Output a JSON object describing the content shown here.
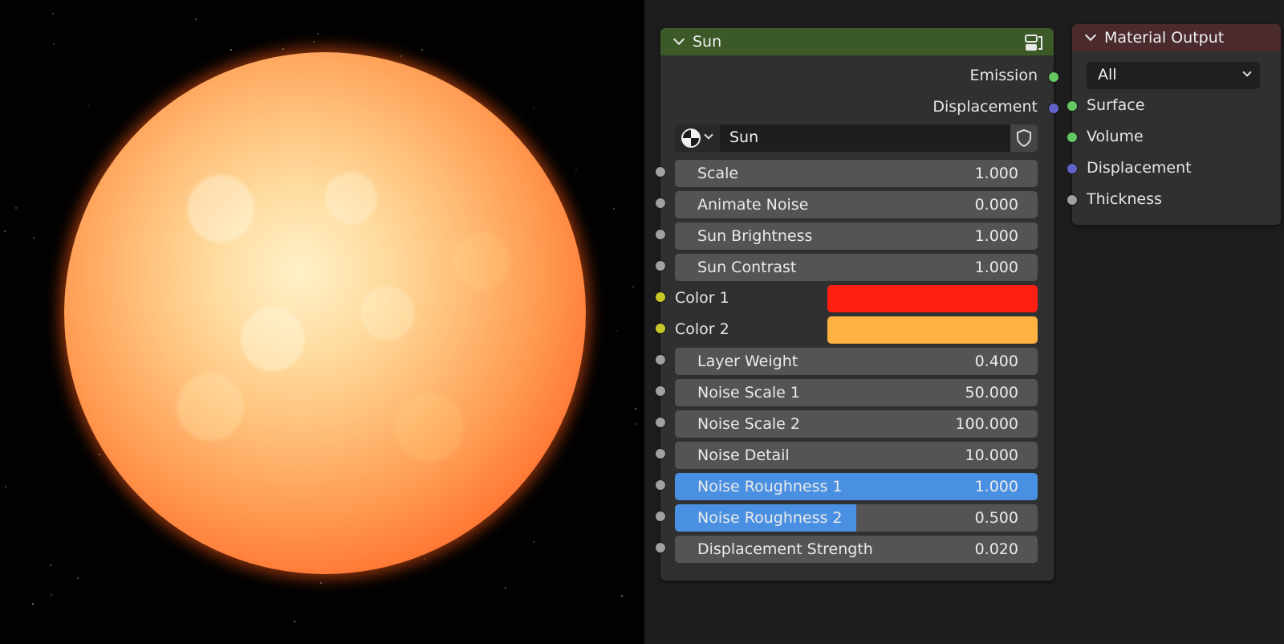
{
  "sun_node": {
    "title": "Sun",
    "outputs": [
      "Emission",
      "Displacement"
    ],
    "material": {
      "name": "Sun"
    },
    "inputs": [
      {
        "label": "Scale",
        "value": "1.000"
      },
      {
        "label": "Animate Noise",
        "value": "0.000"
      },
      {
        "label": "Sun Brightness",
        "value": "1.000"
      },
      {
        "label": "Sun Contrast",
        "value": "1.000"
      }
    ],
    "colors": [
      {
        "label": "Color 1",
        "color": "#ff1f12"
      },
      {
        "label": "Color 2",
        "color": "#ffb142"
      }
    ],
    "inputs2": [
      {
        "label": "Layer Weight",
        "value": "0.400"
      },
      {
        "label": "Noise Scale 1",
        "value": "50.000"
      },
      {
        "label": "Noise Scale 2",
        "value": "100.000"
      },
      {
        "label": "Noise Detail",
        "value": "10.000"
      },
      {
        "label": "Noise Roughness 1",
        "value": "1.000",
        "fraction": 1.0
      },
      {
        "label": "Noise Roughness 2",
        "value": "0.500",
        "fraction": 0.5
      },
      {
        "label": "Displacement Strength",
        "value": "0.020"
      }
    ],
    "header_color": "#3c5a28"
  },
  "material_output": {
    "title": "Material Output",
    "target": "All",
    "inputs": [
      "Surface",
      "Volume",
      "Displacement",
      "Thickness"
    ],
    "header_color": "#4a2a2d"
  },
  "icons": [
    "chevron-down-icon",
    "node-group-icon",
    "material-sphere-icon",
    "fake-user-shield-icon"
  ]
}
